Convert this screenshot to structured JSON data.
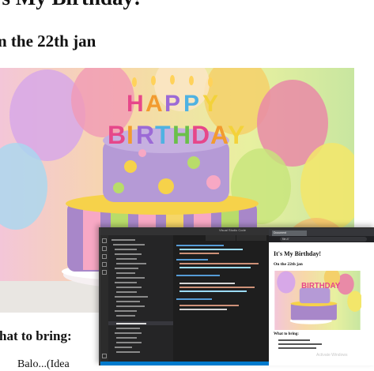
{
  "page": {
    "title": "t's My Birthday!",
    "subtitle": "n the 22th jan",
    "bring_heading": "hat to bring:",
    "bring_item": "Balo...(Idea"
  },
  "editor_screenshot": {
    "window_title": "Visual Studio Code",
    "browser_tab": "Document",
    "browser_url": "file:///",
    "mini_page": {
      "title": "It's My Birthday!",
      "subtitle": "On the 22th jan",
      "bring_heading": "What to bring:",
      "watermark": "Activate Windows"
    }
  },
  "colors": {
    "editor_bg": "#1e1e1e",
    "sidebar_bg": "#252526",
    "status_bar": "#007acc"
  }
}
